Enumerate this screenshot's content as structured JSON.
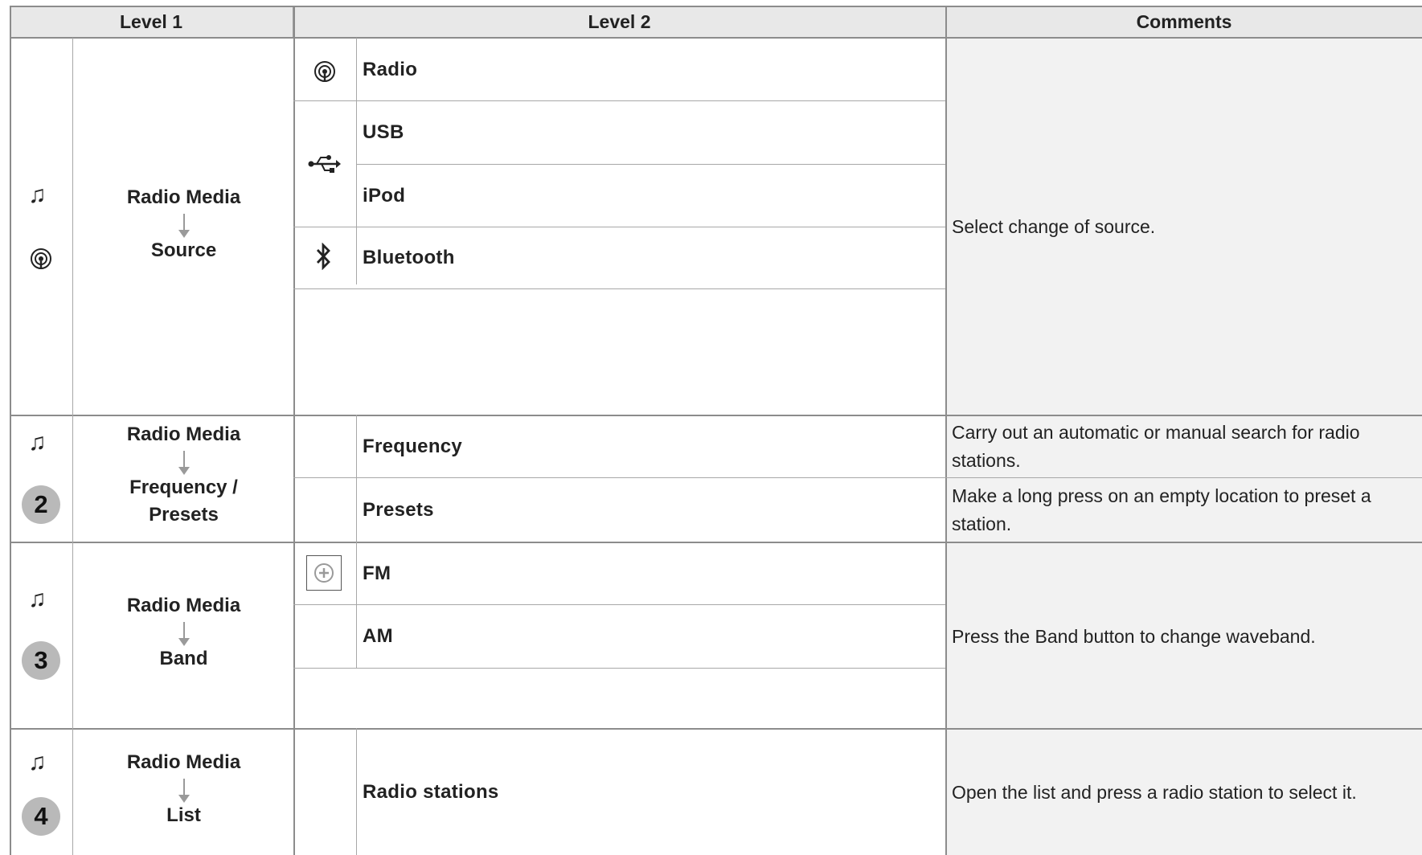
{
  "headers": {
    "level1": "Level 1",
    "level2": "Level 2",
    "comments": "Comments"
  },
  "rows": [
    {
      "level1_icons": [
        "music-note-icon",
        "radio-signal-icon"
      ],
      "level1_top": "Radio Media",
      "level1_bottom": "Source",
      "level2": [
        {
          "label": "Radio",
          "icon": "radio-signal-icon"
        },
        {
          "label": "USB",
          "icon": "usb-icon"
        },
        {
          "label": "iPod",
          "icon": "usb-icon"
        },
        {
          "label": "Bluetooth",
          "icon": "bluetooth-icon"
        }
      ],
      "comment": "Select change of source."
    },
    {
      "level1_icons": [
        "music-note-icon"
      ],
      "number": "2",
      "level1_top": "Radio Media",
      "level1_bottom": "Frequency / Presets",
      "level2": [
        {
          "label": "Frequency",
          "comment": "Carry out an automatic or manual search for radio stations."
        },
        {
          "label": "Presets",
          "comment": "Make a long press on an empty location to preset a station."
        }
      ]
    },
    {
      "level1_icons": [
        "music-note-icon"
      ],
      "number": "3",
      "level1_top": "Radio Media",
      "level1_bottom": "Band",
      "level2": [
        {
          "label": "FM",
          "icon": "plus-circle-icon"
        },
        {
          "label": "AM"
        }
      ],
      "comment": "Press the Band button to change waveband."
    },
    {
      "level1_icons": [
        "music-note-icon"
      ],
      "number": "4",
      "level1_top": "Radio Media",
      "level1_bottom": "List",
      "level2": [
        {
          "label": "Radio stations"
        }
      ],
      "comment": "Open the list and press a radio station to select it."
    }
  ],
  "colors": {
    "header_bg": "#e8e8e8",
    "comment_bg": "#f2f2f2",
    "badge": "#b9b9b9",
    "border": "#8c8c8c"
  }
}
